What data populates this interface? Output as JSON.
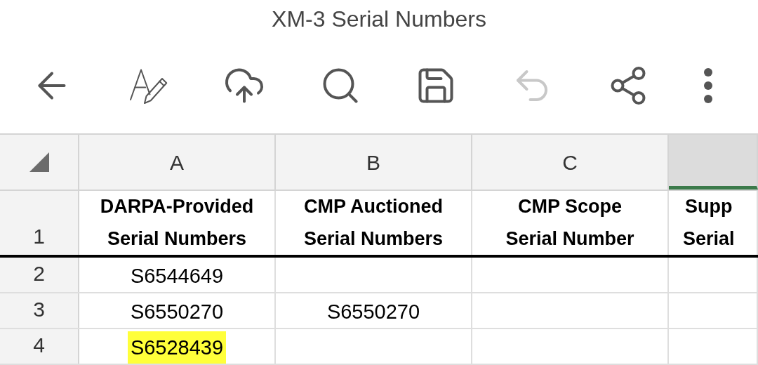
{
  "window": {
    "title": "XM-3 Serial Numbers"
  },
  "toolbar": [
    {
      "kind": "back",
      "disabled": false
    },
    {
      "kind": "edit",
      "disabled": false
    },
    {
      "kind": "upload",
      "disabled": false
    },
    {
      "kind": "search",
      "disabled": false
    },
    {
      "kind": "save",
      "disabled": false
    },
    {
      "kind": "undo",
      "disabled": true
    },
    {
      "kind": "share",
      "disabled": false
    },
    {
      "kind": "more",
      "disabled": false
    }
  ],
  "sheet": {
    "columns": [
      {
        "label": "A",
        "selected": false
      },
      {
        "label": "B",
        "selected": false
      },
      {
        "label": "C",
        "selected": false
      },
      {
        "selected": true
      }
    ],
    "rows": [
      {
        "number": "1",
        "kind": "header",
        "cells": [
          {
            "lines": [
              "DARPA-Provided",
              "Serial Numbers"
            ],
            "highlighted": false
          },
          {
            "lines": [
              "CMP Auctioned",
              "Serial Numbers"
            ],
            "highlighted": false
          },
          {
            "lines": [
              "CMP Scope",
              "Serial Number"
            ],
            "highlighted": false
          },
          {
            "lines": [
              "Supp",
              "Serial"
            ],
            "highlighted": false
          }
        ]
      },
      {
        "number": "2",
        "kind": "data",
        "cells": [
          {
            "lines": [
              "S6544649"
            ],
            "highlighted": false
          },
          {
            "highlighted": false
          },
          {
            "highlighted": false
          },
          {
            "highlighted": false
          }
        ]
      },
      {
        "number": "3",
        "kind": "data",
        "cells": [
          {
            "lines": [
              "S6550270"
            ],
            "highlighted": false
          },
          {
            "lines": [
              "S6550270"
            ],
            "highlighted": false
          },
          {
            "highlighted": false
          },
          {
            "highlighted": false
          }
        ]
      },
      {
        "number": "4",
        "kind": "data",
        "cells": [
          {
            "lines": [
              "S6528439"
            ],
            "highlighted": true
          },
          {
            "highlighted": false
          },
          {
            "highlighted": false
          },
          {
            "highlighted": false
          }
        ]
      }
    ]
  }
}
